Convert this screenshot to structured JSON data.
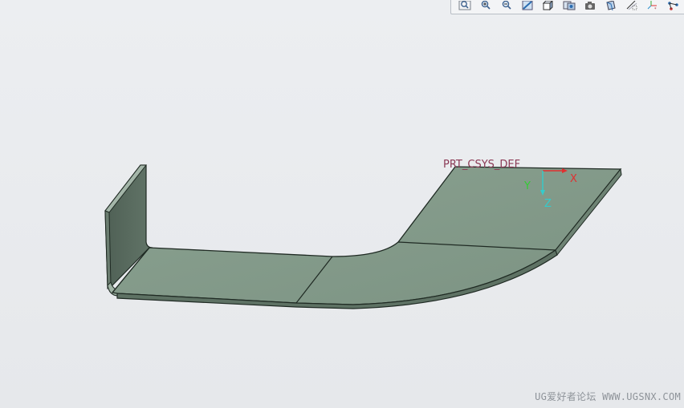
{
  "toolbar": {
    "buttons": [
      {
        "name": "refit-icon"
      },
      {
        "name": "zoom-in-icon"
      },
      {
        "name": "zoom-out-icon"
      },
      {
        "name": "repaint-icon"
      },
      {
        "name": "display-style-icon"
      },
      {
        "name": "saved-orientations-icon"
      },
      {
        "name": "view-manager-icon"
      },
      {
        "name": "section-icon"
      },
      {
        "name": "datum-display-icon"
      },
      {
        "name": "csys-display-icon"
      },
      {
        "name": "annotation-display-icon"
      }
    ]
  },
  "model": {
    "csys_name": "PRT_CSYS_DEF",
    "axes": {
      "x": {
        "label": "X",
        "color": "#e03030"
      },
      "y": {
        "label": "Y",
        "color": "#33cc33"
      },
      "z": {
        "label": "Z",
        "color": "#33cccc"
      }
    },
    "part_color": "#83998a"
  },
  "watermark": "UG爱好者论坛 WWW.UGSNX.COM"
}
